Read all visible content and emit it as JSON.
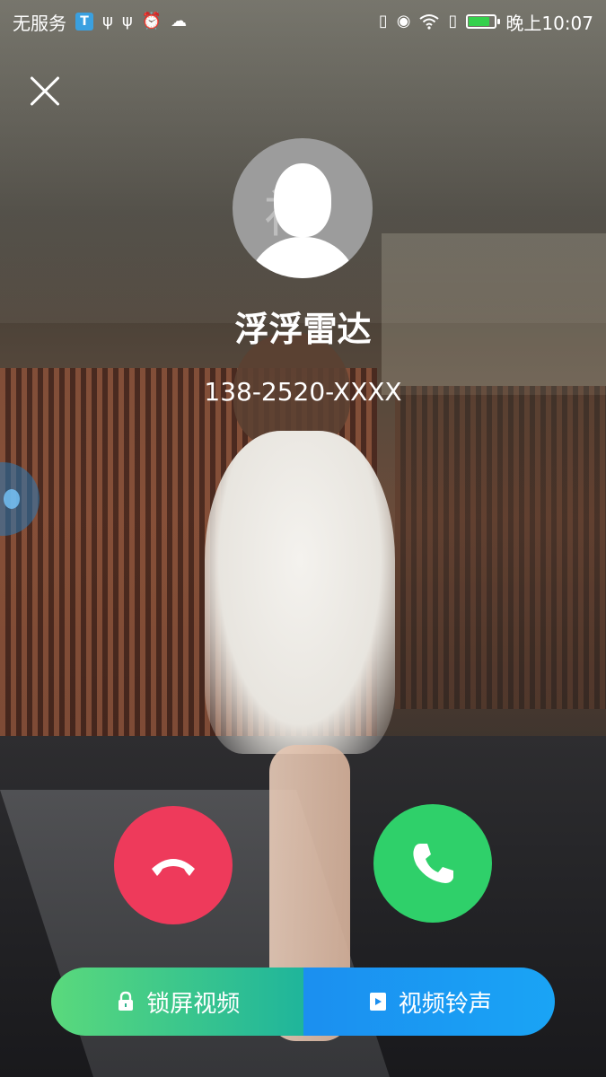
{
  "status_bar": {
    "carrier": "无服务",
    "time": "晚上10:07",
    "battery_level": 0.8,
    "left_icons": [
      "t-app-icon",
      "usb-icon",
      "usb-icon",
      "alarm-icon",
      "cloud-icon"
    ],
    "right_icons": [
      "vibrate-icon",
      "eye-icon",
      "wifi-icon",
      "sim-alert-icon",
      "battery-icon"
    ]
  },
  "caller": {
    "name": "浮浮雷达",
    "number": "138-2520-XXXX",
    "avatar_watermark": "衬衫"
  },
  "actions": {
    "decline_color": "#ee3a5b",
    "accept_color": "#2fd06a"
  },
  "bottom_bar": {
    "lock_screen_video": "锁屏视频",
    "video_ringtone": "视频铃声"
  },
  "colors": {
    "bottom_left_start": "#5ad97c",
    "bottom_left_end": "#1fb59b",
    "bottom_right": "#1b8ff0"
  }
}
